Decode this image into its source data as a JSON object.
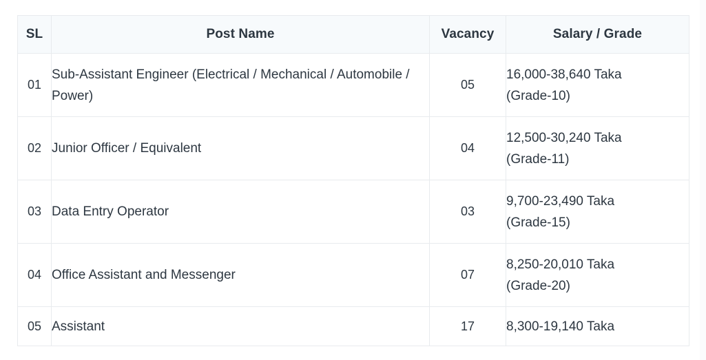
{
  "table": {
    "columns": [
      {
        "key": "sl",
        "label": "SL"
      },
      {
        "key": "post_name",
        "label": "Post Name"
      },
      {
        "key": "vacancy",
        "label": "Vacancy"
      },
      {
        "key": "salary_grade",
        "label": "Salary / Grade"
      }
    ],
    "rows": [
      {
        "sl": "01",
        "post_name": "Sub-Assistant Engineer (Electrical / Mechanical / Automobile / Power)",
        "vacancy": "05",
        "salary": "16,000-38,640 Taka",
        "grade": "(Grade-10)"
      },
      {
        "sl": "02",
        "post_name": "Junior Officer / Equivalent",
        "vacancy": "04",
        "salary": "12,500-30,240 Taka",
        "grade": "(Grade-11)"
      },
      {
        "sl": "03",
        "post_name": "Data Entry Operator",
        "vacancy": "03",
        "salary": "9,700-23,490 Taka",
        "grade": "(Grade-15)"
      },
      {
        "sl": "04",
        "post_name": "Office Assistant and Messenger",
        "vacancy": "07",
        "salary": "8,250-20,010 Taka",
        "grade": "(Grade-20)"
      },
      {
        "sl": "05",
        "post_name": "Assistant",
        "vacancy": "17",
        "salary": "8,300-19,140 Taka",
        "grade": ""
      }
    ]
  },
  "colors": {
    "header_bg": "#f7fafc",
    "border": "#e8ebee",
    "text": "#2d3741",
    "header_text": "#1a202c",
    "page_bg": "#ffffff"
  }
}
